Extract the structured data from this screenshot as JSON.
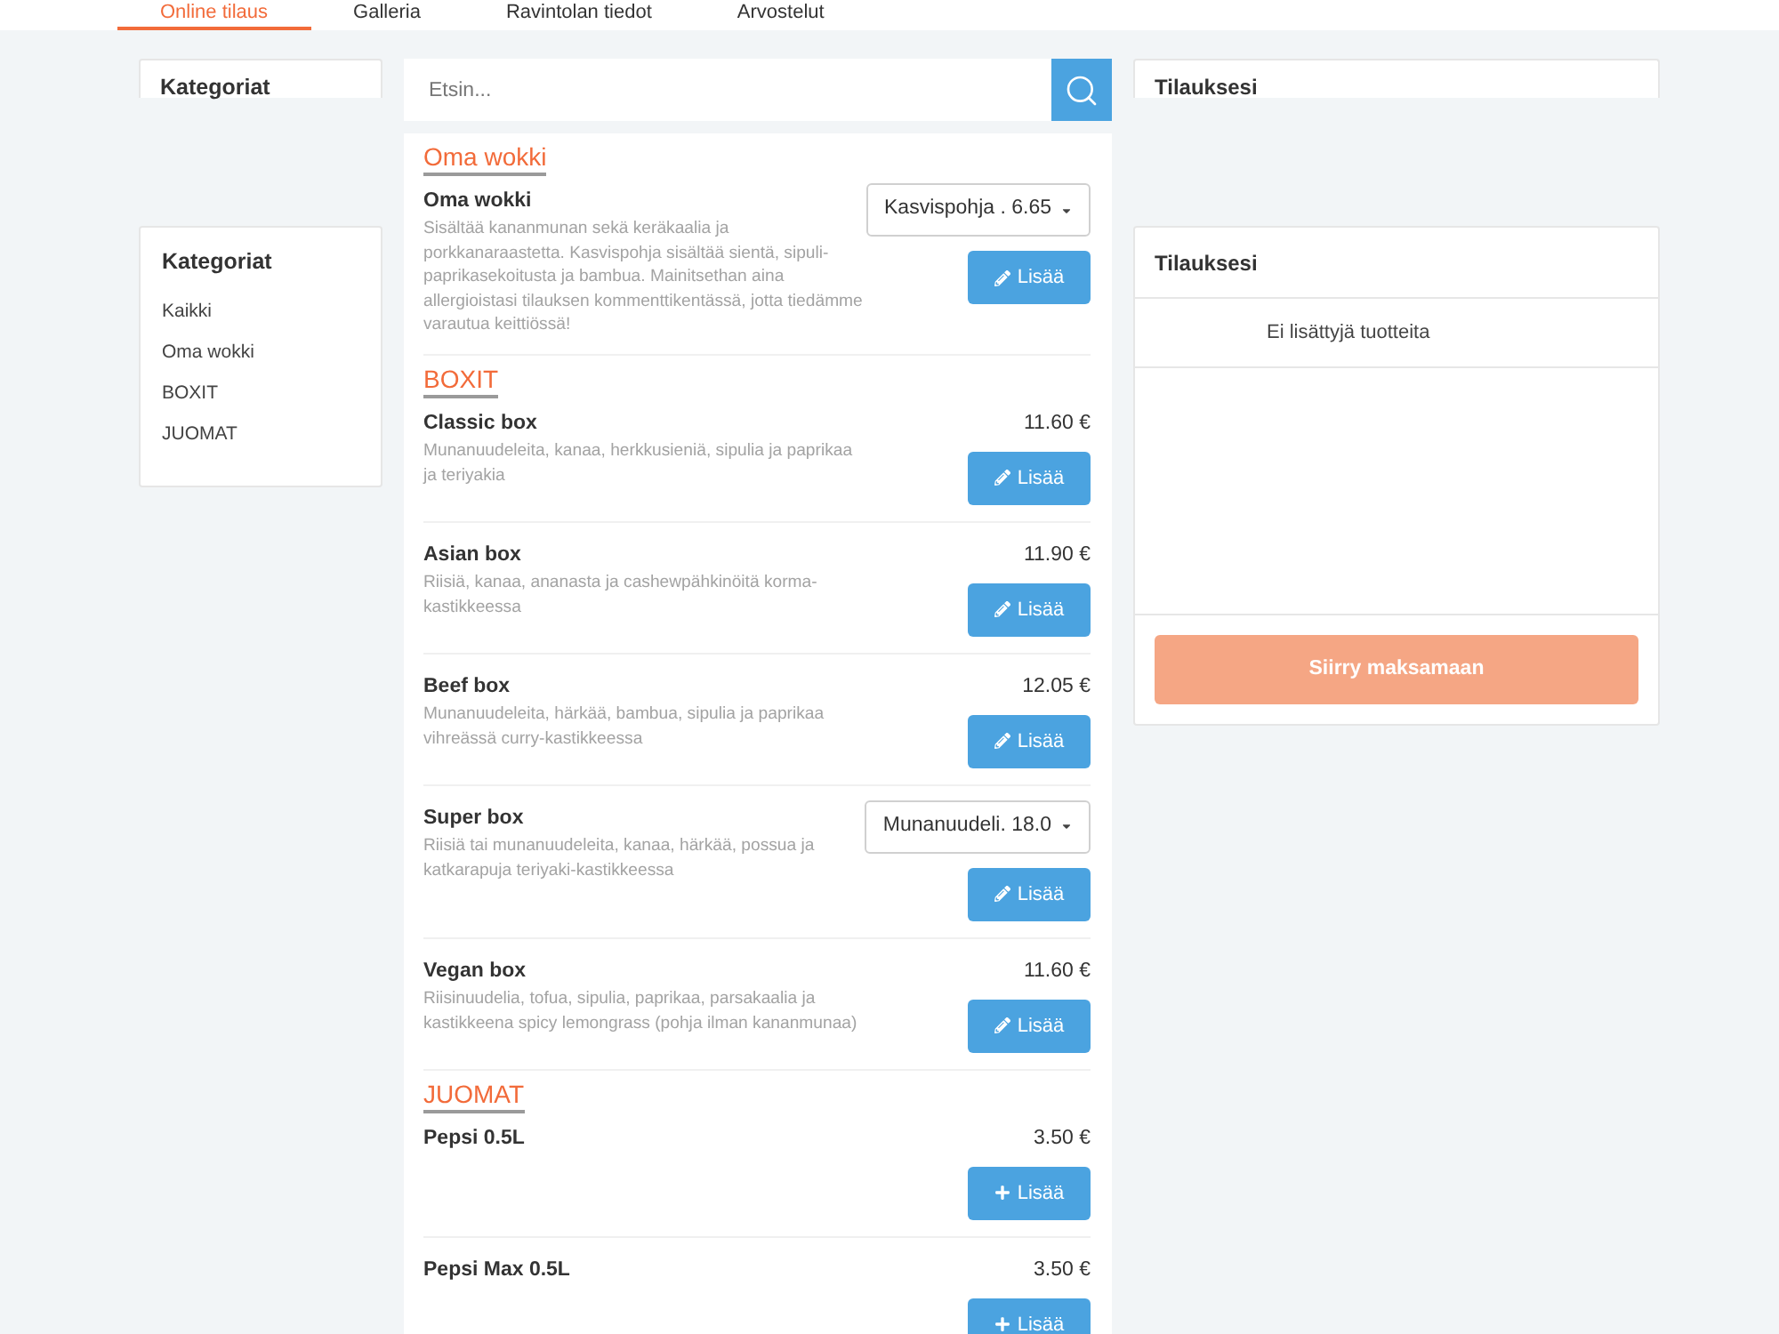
{
  "nav": {
    "tabs": [
      {
        "label": "Online tilaus",
        "selected": true
      },
      {
        "label": "Galleria",
        "selected": false
      },
      {
        "label": "Ravintolan tiedot",
        "selected": false
      },
      {
        "label": "Arvostelut",
        "selected": false
      }
    ]
  },
  "sticky_headers": {
    "categories_title": "Kategoriat",
    "order_title": "Tilauksesi"
  },
  "search": {
    "placeholder": "Etsin..."
  },
  "categories": {
    "title": "Kategoriat",
    "items": [
      {
        "label": "Kaikki"
      },
      {
        "label": "Oma wokki"
      },
      {
        "label": "BOXIT"
      },
      {
        "label": "JUOMAT"
      }
    ]
  },
  "menu": {
    "sections": [
      {
        "title": "Oma wokki",
        "items": [
          {
            "name": "Oma wokki",
            "description": "Sisältää kananmunan sekä keräkaalia ja porkkanaraastetta. Kasvispohja sisältää sientä, sipuli-paprikasekoitusta ja bambua. Mainitsethan aina allergioistasi tilauksen kommenttikentässä, jotta tiedämme varautua keittiössä!",
            "kind": "select",
            "option": "Kasvispohja . 6.65",
            "customizable": true,
            "button": "Lisää"
          }
        ]
      },
      {
        "title": "BOXIT",
        "items": [
          {
            "name": "Classic box",
            "description": "Munanuudeleita, kanaa, herkkusieniä, sipulia ja paprikaa ja teriyakia",
            "kind": "price",
            "price": "11.60 €",
            "customizable": true,
            "button": "Lisää"
          },
          {
            "name": "Asian box",
            "description": "Riisiä, kanaa, ananasta ja cashewpähkinöitä korma-kastikkeessa",
            "kind": "price",
            "price": "11.90 €",
            "customizable": true,
            "button": "Lisää"
          },
          {
            "name": "Beef box",
            "description": "Munanuudeleita, härkää, bambua, sipulia ja paprikaa vihreässä curry-kastikkeessa",
            "kind": "price",
            "price": "12.05 €",
            "customizable": true,
            "button": "Lisää"
          },
          {
            "name": "Super box",
            "description": "Riisiä tai munanuudeleita, kanaa, härkää, possua ja katkarapuja teriyaki-kastikkeessa",
            "kind": "select",
            "option": "Munanuudeli. 18.0",
            "customizable": true,
            "button": "Lisää"
          },
          {
            "name": "Vegan box",
            "description": "Riisinuudelia, tofua, sipulia, paprikaa, parsakaalia ja kastikkeena spicy lemongrass (pohja ilman kananmunaa)",
            "kind": "price",
            "price": "11.60 €",
            "customizable": true,
            "button": "Lisää"
          }
        ]
      },
      {
        "title": "JUOMAT",
        "items": [
          {
            "name": "Pepsi 0.5L",
            "kind": "price",
            "price": "3.50 €",
            "customizable": false,
            "button": "Lisää"
          },
          {
            "name": "Pepsi Max 0.5L",
            "kind": "price",
            "price": "3.50 €",
            "customizable": false,
            "button": "Lisää"
          }
        ]
      }
    ]
  },
  "order": {
    "title": "Tilauksesi",
    "empty_text": "Ei lisättyjä tuotteita",
    "checkout_button": {
      "label": "Siirry maksamaan",
      "disabled": true
    }
  }
}
